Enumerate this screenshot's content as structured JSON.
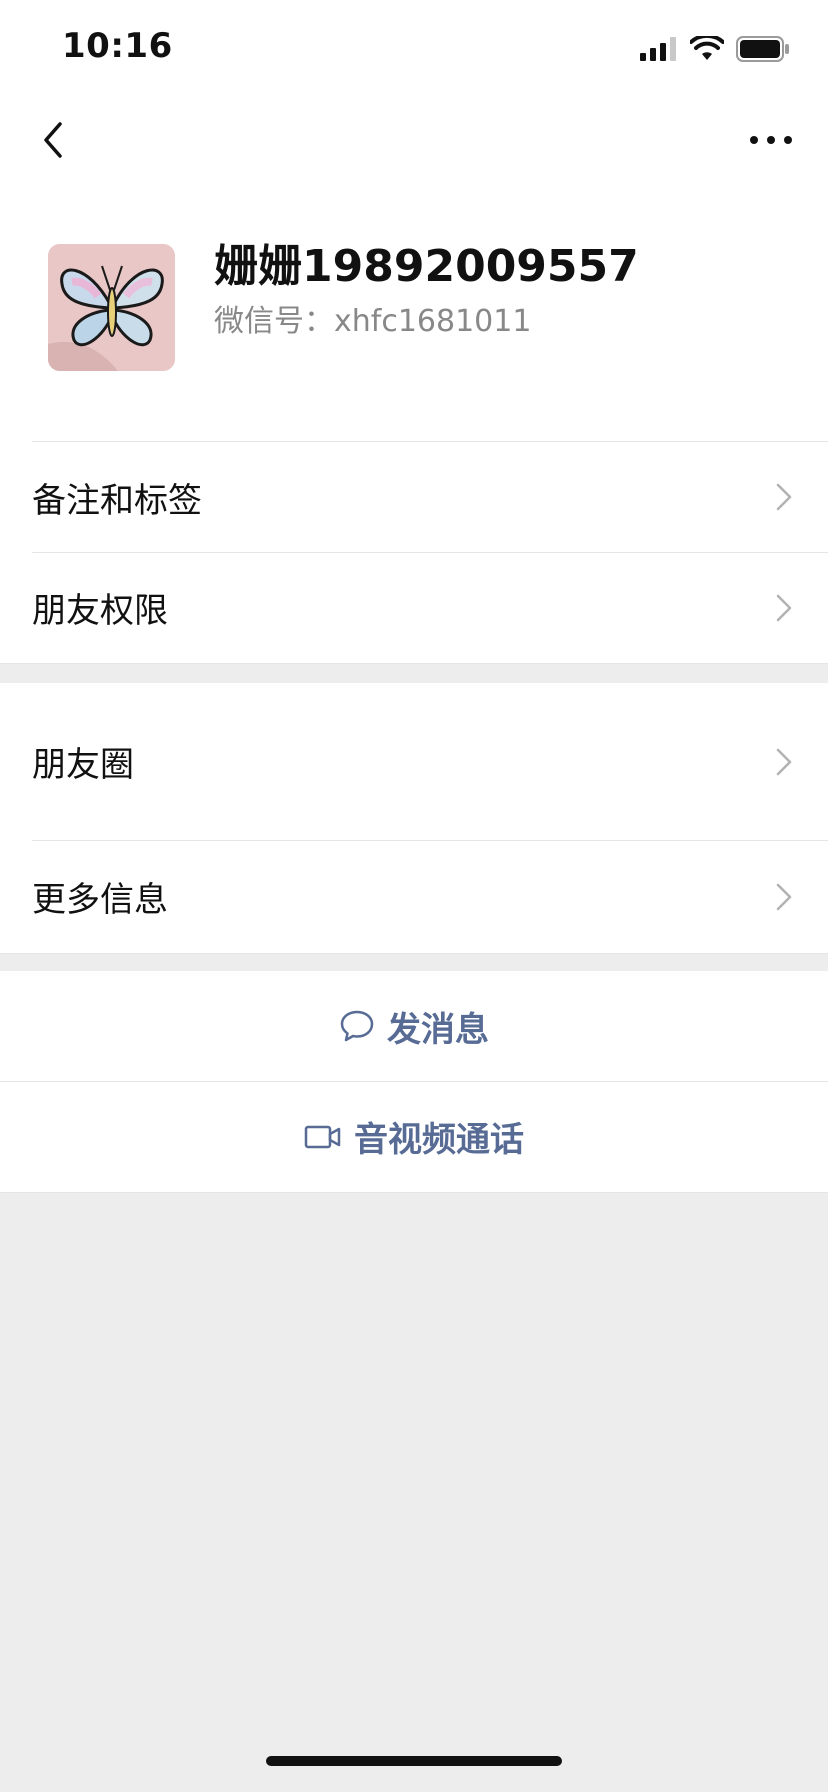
{
  "status_bar": {
    "time": "10:16"
  },
  "profile": {
    "name": "姗姗19892009557",
    "wechat_id_label": "微信号：",
    "wechat_id": "xhfc1681011"
  },
  "menu_group_1": [
    {
      "label": "备注和标签"
    },
    {
      "label": "朋友权限"
    }
  ],
  "menu_group_2": [
    {
      "label": "朋友圈"
    },
    {
      "label": "更多信息"
    }
  ],
  "actions": {
    "send_message": "发消息",
    "av_call": "音视频通话"
  },
  "colors": {
    "link": "#576b95",
    "background": "#ededed",
    "surface": "#ffffff"
  }
}
